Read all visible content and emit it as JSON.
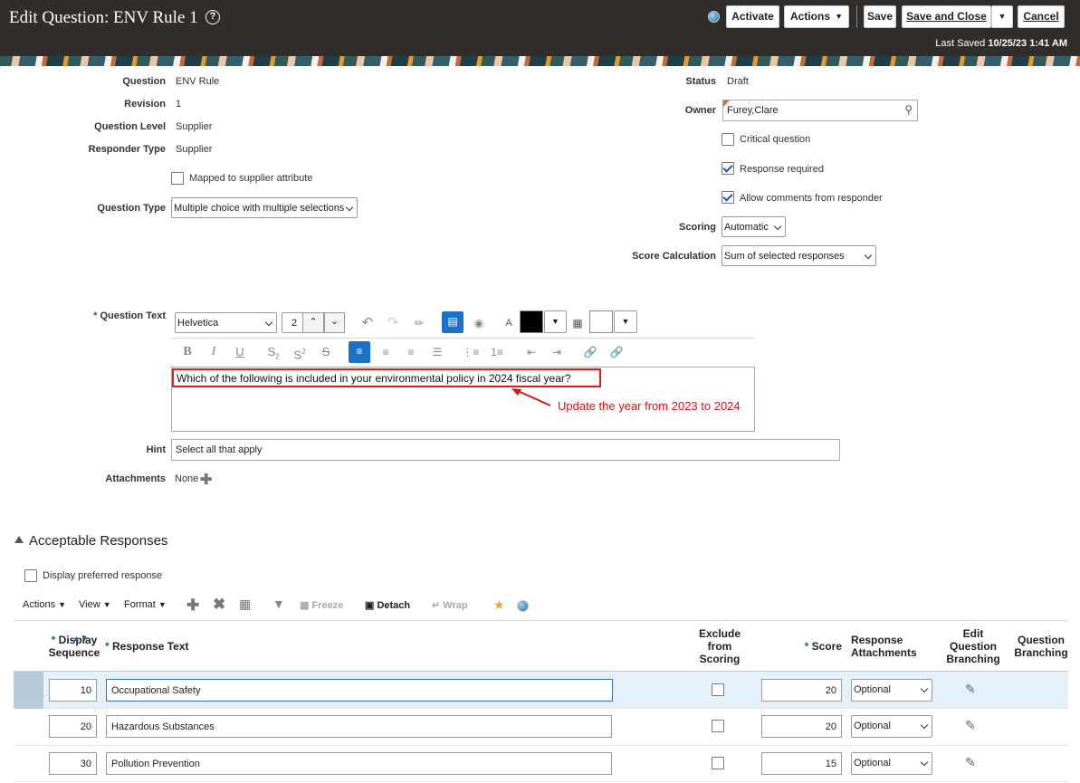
{
  "header": {
    "title": "Edit Question: ENV Rule 1",
    "help": "?",
    "activate": "Activate",
    "actions": "Actions",
    "save": "Save",
    "save_and_close": "Save and Close",
    "cancel": "Cancel",
    "last_saved_label": "Last Saved",
    "last_saved_value": "10/25/23 1:41 AM"
  },
  "form": {
    "question_label": "Question",
    "question_value": "ENV Rule",
    "revision_label": "Revision",
    "revision_value": "1",
    "level_label": "Question Level",
    "level_value": "Supplier",
    "responder_label": "Responder Type",
    "responder_value": "Supplier",
    "mapped_label": "Mapped to supplier attribute",
    "type_label": "Question Type",
    "type_value": "Multiple choice with multiple selections",
    "status_label": "Status",
    "status_value": "Draft",
    "owner_label": "Owner",
    "owner_value": "Furey,Clare",
    "critical_label": "Critical question",
    "required_label": "Response required",
    "comments_label": "Allow comments from responder",
    "scoring_label": "Scoring",
    "scoring_value": "Automatic",
    "score_calc_label": "Score Calculation",
    "score_calc_value": "Sum of selected responses",
    "qtext_label": "Question Text",
    "font_value": "Helvetica",
    "size_value": "2",
    "question_text": "Which of the following is included in your environmental policy in 2024 fiscal year?",
    "annotation": "Update the year from 2023 to 2024",
    "hint_label": "Hint",
    "hint_value": "Select all that apply",
    "attachments_label": "Attachments",
    "attachments_value": "None"
  },
  "responses": {
    "section_title": "Acceptable Responses",
    "display_preferred": "Display preferred response",
    "menu_actions": "Actions",
    "menu_view": "View",
    "menu_format": "Format",
    "freeze": "Freeze",
    "detach": "Detach",
    "wrap": "Wrap",
    "col_seq_1": "Display",
    "col_seq_2": "Sequence",
    "col_text": "Response Text",
    "col_exclude_1": "Exclude",
    "col_exclude_2": "from",
    "col_exclude_3": "Scoring",
    "col_score": "Score",
    "col_attach_1": "Response",
    "col_attach_2": "Attachments",
    "col_edit_1": "Edit",
    "col_edit_2": "Question",
    "col_edit_3": "Branching",
    "col_branch_1": "Question",
    "col_branch_2": "Branching",
    "rows": [
      {
        "seq": "10",
        "text": "Occupational Safety",
        "score": "20",
        "attach": "Optional"
      },
      {
        "seq": "20",
        "text": "Hazardous Substances",
        "score": "20",
        "attach": "Optional"
      },
      {
        "seq": "30",
        "text": "Pollution Prevention",
        "score": "15",
        "attach": "Optional"
      }
    ]
  }
}
